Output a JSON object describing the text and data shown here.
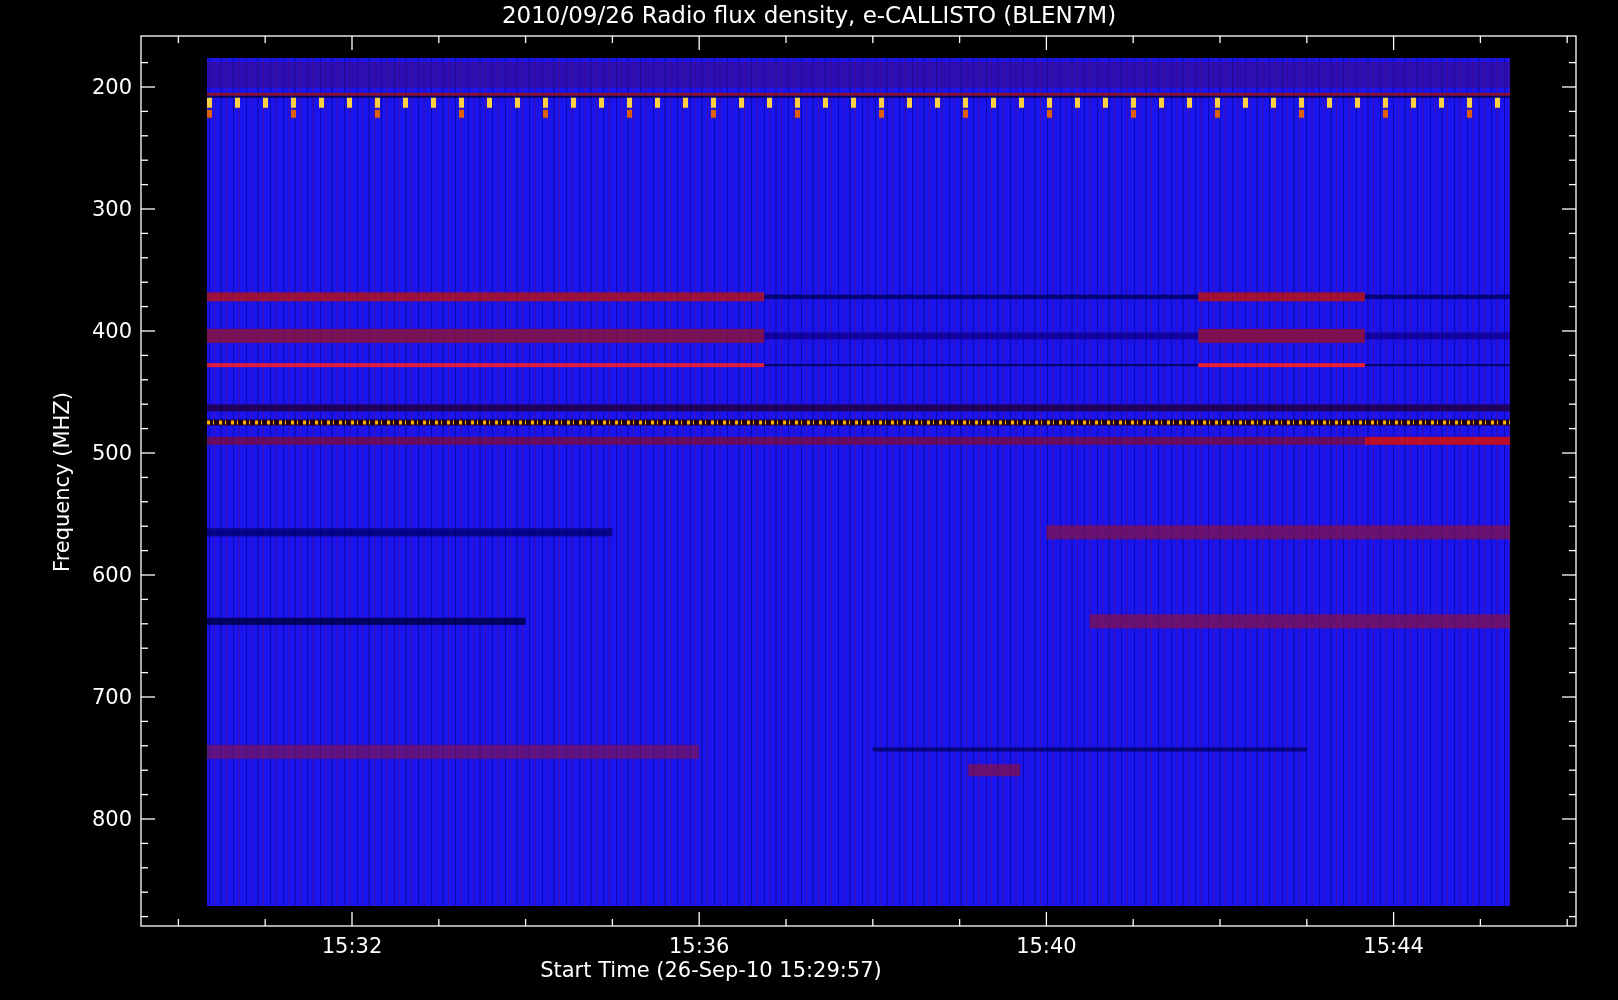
{
  "title": "2010/09/26  Radio flux density, e-CALLISTO (BLEN7M)",
  "chart": {
    "ylabel": "Frequency (MHZ)",
    "xlabel": "Start Time (26-Sep-10 15:29:57)",
    "yticks": [
      "200",
      "300",
      "400",
      "500",
      "600",
      "700",
      "800"
    ],
    "xticks": [
      "15:32",
      "15:36",
      "15:40",
      "15:44"
    ]
  }
}
